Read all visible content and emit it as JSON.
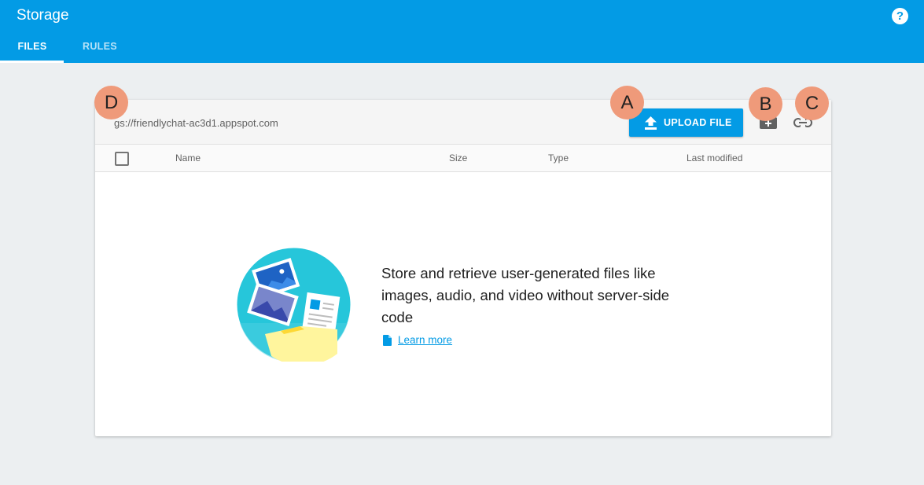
{
  "app": {
    "title": "Storage",
    "help_icon": "help-icon"
  },
  "tabs": [
    {
      "label": "FILES",
      "active": true
    },
    {
      "label": "RULES",
      "active": false
    }
  ],
  "bucket": {
    "path": "gs://friendlychat-ac3d1.appspot.com",
    "upload_label": "UPLOAD FILE",
    "upload_icon": "upload-icon",
    "add_folder_icon": "create-folder-icon",
    "link_icon": "link-icon"
  },
  "table": {
    "columns": [
      "Name",
      "Size",
      "Type",
      "Last modified"
    ]
  },
  "empty_state": {
    "message": "Store and retrieve user-generated files like images, audio, and video without server-side code",
    "link_label": "Learn more",
    "link_icon": "document-icon"
  },
  "markers": [
    "D",
    "A",
    "B",
    "C"
  ],
  "colors": {
    "primary": "#039be5",
    "marker": "#ef9a7a",
    "background": "#eceff1",
    "illustration_teal": "#26c6da"
  }
}
